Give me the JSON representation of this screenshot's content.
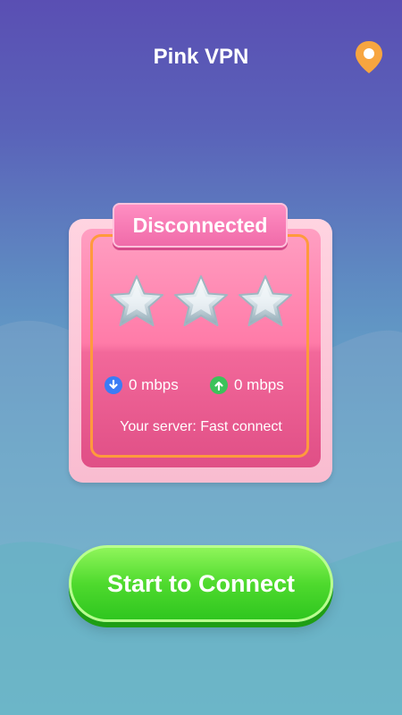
{
  "header": {
    "title": "Pink VPN"
  },
  "location_button": {
    "icon": "location-pin-icon",
    "color": "#f7a540"
  },
  "status": {
    "label": "Disconnected"
  },
  "rating": {
    "stars": 3,
    "icon": "star-icon"
  },
  "speed": {
    "download": {
      "label": "0 mbps",
      "icon": "download-arrow-icon",
      "color": "#3b7cf5"
    },
    "upload": {
      "label": "0 mbps",
      "icon": "upload-arrow-icon",
      "color": "#3cc25a"
    }
  },
  "server": {
    "label": "Your server: Fast connect"
  },
  "connect_button": {
    "label": "Start to Connect"
  },
  "colors": {
    "accent_pink": "#ff7ba8",
    "frame_orange": "#ff9a3c",
    "button_green": "#4fda2e"
  }
}
